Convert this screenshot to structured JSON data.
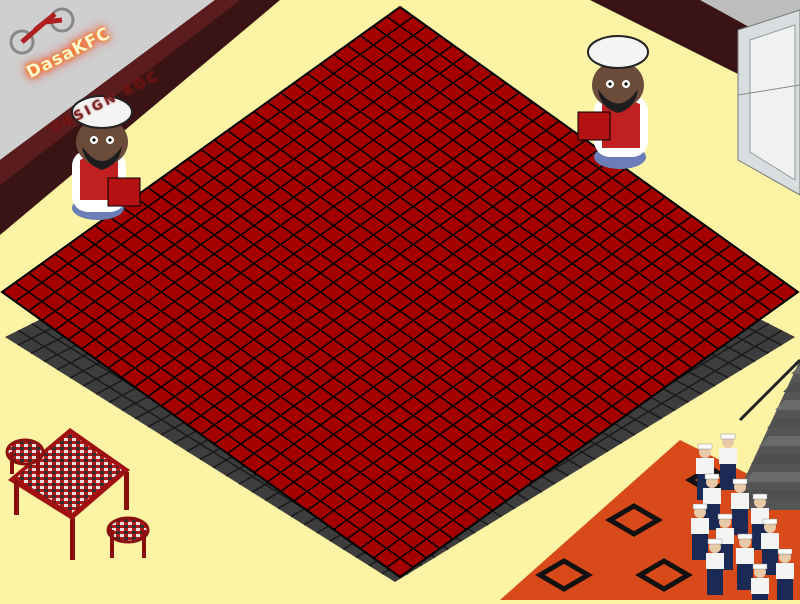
{
  "scene": {
    "title": "Habbo-style isometric restaurant room",
    "sign_text": "DasaKFC",
    "sign_subtext": "DESIGN KOC",
    "dancefloor_tiles": 30,
    "colors": {
      "floor": "#fdf3a5",
      "wall_dark": "#3a1414",
      "tile_red": "#a50000",
      "tile_border": "#000000",
      "tile_gray": "#4a4a4a",
      "rug_orange": "#d84a1a"
    }
  },
  "items": {
    "chef_left": "chef-npc",
    "chef_right": "chef-npc",
    "table": "dining-table",
    "display_case": "glass-display-case",
    "staircase": "staircase",
    "crowd": "sailor-crowd"
  }
}
